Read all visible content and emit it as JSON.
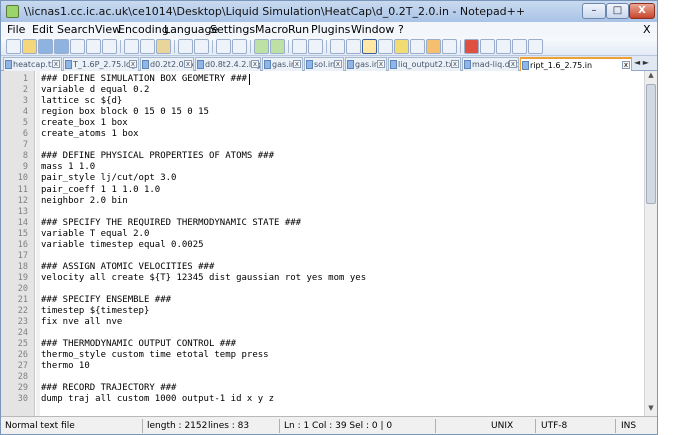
{
  "window": {
    "title": "\\\\icnas1.cc.ic.ac.uk\\ce1014\\Desktop\\Liquid Simulation\\HeatCap\\d_0.2T_2.0.in - Notepad++",
    "minimize_label": "–",
    "maximize_label": "□",
    "close_label": "X"
  },
  "menu": [
    "File",
    "Edit",
    "Search",
    "View",
    "Encoding",
    "Language",
    "Settings",
    "Macro",
    "Run",
    "Plugins",
    "Window",
    "?"
  ],
  "menu_close": "X",
  "toolbar_icons": [
    "new-file-icon",
    "open-file-icon",
    "save-icon",
    "save-all-icon",
    "close-icon",
    "close-all-icon",
    "print-icon",
    "cut-icon",
    "copy-icon",
    "paste-icon",
    "undo-icon",
    "redo-icon",
    "find-icon",
    "replace-icon",
    "zoom-in-icon",
    "zoom-out-icon",
    "sync-v-icon",
    "sync-h-icon",
    "word-wrap-icon",
    "show-all-icon",
    "indent-guide-icon",
    "user-lang-icon",
    "doc-map-icon",
    "function-list-icon",
    "folder-icon",
    "monitor-icon",
    "record-macro-icon",
    "stop-macro-icon",
    "play-macro-icon",
    "play-multiple-icon",
    "save-macro-icon"
  ],
  "tabs": [
    {
      "label": "heatcap.txt",
      "active": false
    },
    {
      "label": "T_1.6P_2.75.log",
      "active": false
    },
    {
      "label": "d0.2t2.0.log",
      "active": false
    },
    {
      "label": "d0.8t2.4.2.log",
      "active": false
    },
    {
      "label": "gas.in",
      "active": false
    },
    {
      "label": "sol.in",
      "active": false
    },
    {
      "label": "gas.in",
      "active": false
    },
    {
      "label": "liq_output2.txt",
      "active": false
    },
    {
      "label": "mad-liq.dat",
      "active": false
    },
    {
      "label": "ript_1.6_2.75.in",
      "active": true
    }
  ],
  "tab_scroll": "◄ ►",
  "code_lines": [
    "### DEFINE SIMULATION BOX GEOMETRY ###",
    "variable d equal 0.2",
    "lattice sc ${d}",
    "region box block 0 15 0 15 0 15",
    "create_box 1 box",
    "create_atoms 1 box",
    "",
    "### DEFINE PHYSICAL PROPERTIES OF ATOMS ###",
    "mass 1 1.0",
    "pair_style lj/cut/opt 3.0",
    "pair_coeff 1 1 1.0 1.0",
    "neighbor 2.0 bin",
    "",
    "### SPECIFY THE REQUIRED THERMODYNAMIC STATE ###",
    "variable T equal 2.0",
    "variable timestep equal 0.0025",
    "",
    "### ASSIGN ATOMIC VELOCITIES ###",
    "velocity all create ${T} 12345 dist gaussian rot yes mom yes",
    "",
    "### SPECIFY ENSEMBLE ###",
    "timestep ${timestep}",
    "fix nve all nve",
    "",
    "### THERMODYNAMIC OUTPUT CONTROL ###",
    "thermo_style custom time etotal temp press",
    "thermo 10",
    "",
    "### RECORD TRAJECTORY ###",
    "dump traj all custom 1000 output-1 id x y z"
  ],
  "status": {
    "file_type": "Normal text file",
    "length": "length : 2152",
    "lines": "lines : 83",
    "position": "Ln : 1    Col : 39    Sel : 0 | 0",
    "eol": "UNIX",
    "encoding": "UTF-8",
    "mode": "INS"
  }
}
